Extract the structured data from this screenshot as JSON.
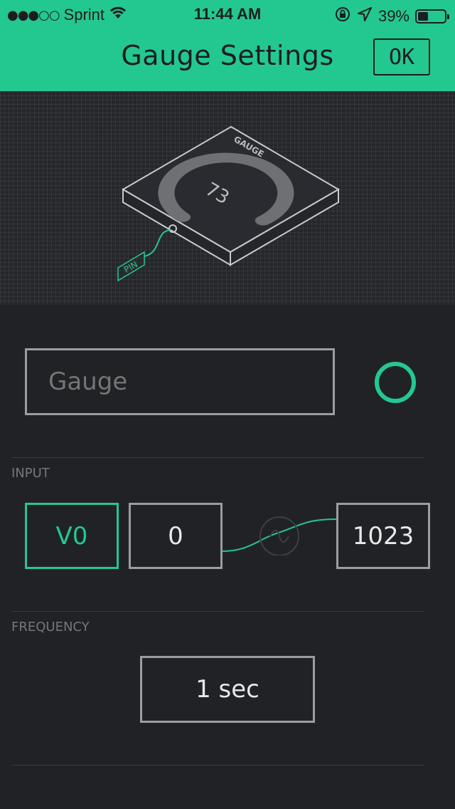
{
  "status_bar": {
    "carrier": "Sprint",
    "signal_dots": "●●●○○",
    "time": "11:44 AM",
    "battery_percent": "39%",
    "battery_level": 0.39
  },
  "header": {
    "title": "Gauge Settings",
    "ok_label": "OK",
    "accent_color": "#23c891"
  },
  "preview": {
    "widget_label": "GAUGE",
    "gauge_value": "73",
    "pin_label": "PIN"
  },
  "name_field": {
    "placeholder": "Gauge",
    "value": ""
  },
  "color_picker": {
    "color": "#23c891"
  },
  "input_section": {
    "label": "INPUT",
    "pin": "V0",
    "min": "0",
    "max": "1023"
  },
  "frequency_section": {
    "label": "FREQUENCY",
    "value": "1 sec"
  }
}
